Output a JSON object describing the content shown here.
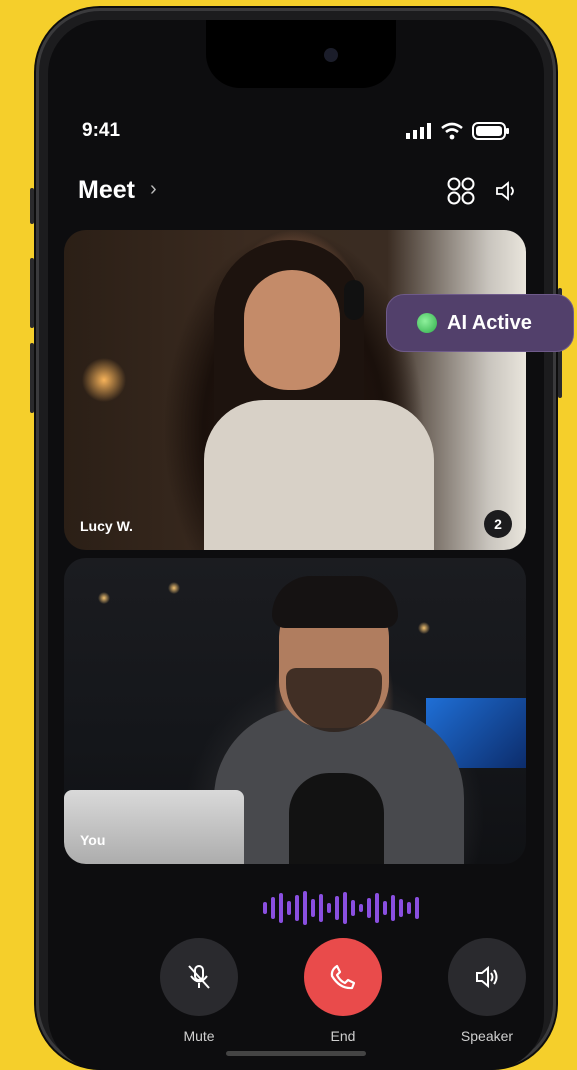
{
  "status_bar": {
    "time": "9:41"
  },
  "header": {
    "title": "Meet",
    "chevron": "›"
  },
  "participants": [
    {
      "name": "Lucy W.",
      "badge": "2"
    },
    {
      "name": "You"
    }
  ],
  "ai_status": {
    "label": "AI Active",
    "color": "#52406b"
  },
  "controls": {
    "mute": {
      "label": "Mute",
      "icon": "mic-off-icon"
    },
    "end": {
      "label": "End",
      "icon": "phone-icon",
      "color": "#e94b4b"
    },
    "speaker": {
      "label": "Speaker",
      "icon": "speaker-icon"
    }
  },
  "colors": {
    "background": "#f5cf2b",
    "accent": "#8a4fe0"
  }
}
